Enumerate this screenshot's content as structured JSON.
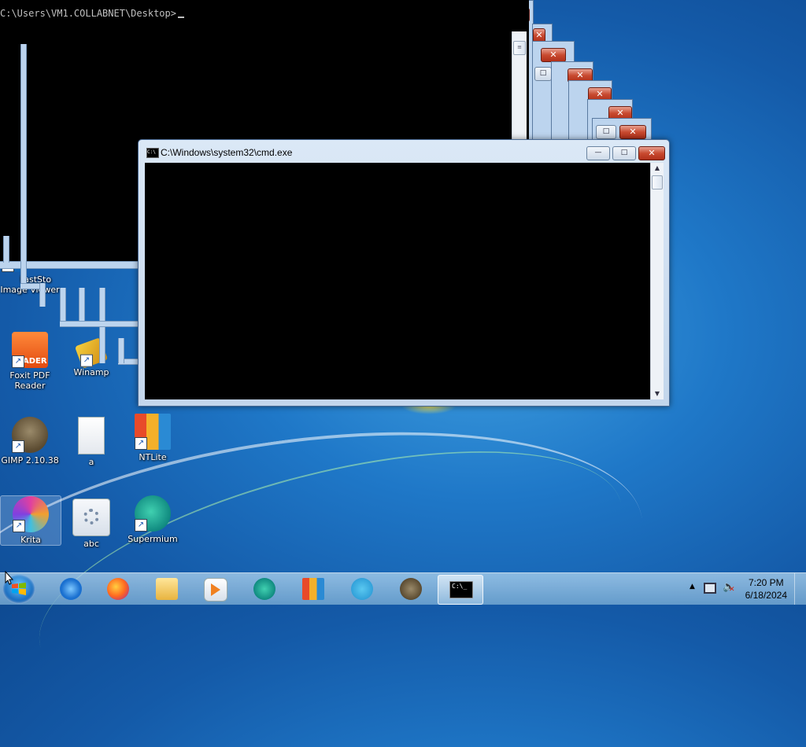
{
  "console": {
    "prompt": "C:\\Users\\VM1.COLLABNET\\Desktop>"
  },
  "cmd_window": {
    "title": "C:\\Windows\\system32\\cmd.exe",
    "minimize_glyph": "—",
    "maximize_glyph": "□",
    "close_glyph": "✕"
  },
  "desktop_icons": [
    {
      "label": "FastStone Image Viewer",
      "name": "faststone-image-viewer"
    },
    {
      "label": "Foxit PDF Reader",
      "name": "foxit-pdf-reader"
    },
    {
      "label": "Winamp",
      "name": "winamp"
    },
    {
      "label": "GIMP 2.10.38",
      "name": "gimp"
    },
    {
      "label": "a",
      "name": "a-text-file"
    },
    {
      "label": "NTLite",
      "name": "ntlite"
    },
    {
      "label": "Krita",
      "name": "krita"
    },
    {
      "label": "abc",
      "name": "abc"
    },
    {
      "label": "Supermium",
      "name": "supermium"
    }
  ],
  "desktop_icon_labels": {
    "faststone_line1": "FastSto",
    "faststone_line2": "Image Viewer",
    "foxit_line1": "Foxit PDF",
    "foxit_line2": "Reader",
    "foxit_badge": "ADER",
    "winamp": "Winamp",
    "gimp": "GIMP 2.10.38",
    "a": "a",
    "ntlite": "NTLite",
    "krita": "Krita",
    "abc": "abc",
    "supermium": "Supermium"
  },
  "taskbar": {
    "pinned": [
      "internet-explorer",
      "firefox",
      "file-explorer",
      "media-player",
      "supermium",
      "ntlite",
      "telegram",
      "gimp",
      "command-prompt"
    ],
    "active": "command-prompt",
    "console_glyph": "C:\\_"
  },
  "tray": {
    "time": "7:20 PM",
    "date": "6/18/2024",
    "icons": [
      "show-hidden-icons",
      "network-icon",
      "volume-muted-icon"
    ]
  },
  "colors": {
    "desktop": "#1f78c8",
    "close_red": "#c84a30",
    "console_bg": "#000000",
    "console_text": "#c0c0c0"
  }
}
